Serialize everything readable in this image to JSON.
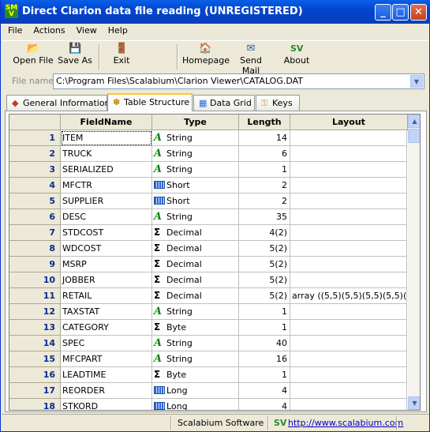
{
  "window": {
    "title": "Direct Clarion data file reading (UNREGISTERED)",
    "icon_text": "SM V"
  },
  "menu": [
    "File",
    "Actions",
    "View",
    "Help"
  ],
  "toolbar": {
    "open_label": "Open File",
    "save_label": "Save As",
    "exit_label": "Exit",
    "homepage_label": "Homepage",
    "sendmail_label": "Send Mail",
    "about_label": "About"
  },
  "filename": {
    "label": "File name:",
    "value": "C:\\Program Files\\Scalabium\\Clarion Viewer\\CATALOG.DAT"
  },
  "tabs": [
    "General Information",
    "Table Structure",
    "Data Grid",
    "Keys"
  ],
  "active_tab": "Table Structure",
  "grid": {
    "columns": [
      "FieldName",
      "Type",
      "Length",
      "Layout"
    ],
    "rows": [
      {
        "n": "1",
        "field": "ITEM",
        "type": "String",
        "icon": "string-icon",
        "length": "14",
        "layout": ""
      },
      {
        "n": "2",
        "field": "TRUCK",
        "type": "String",
        "icon": "string-icon",
        "length": "6",
        "layout": ""
      },
      {
        "n": "3",
        "field": "SERIALIZED",
        "type": "String",
        "icon": "string-icon",
        "length": "1",
        "layout": ""
      },
      {
        "n": "4",
        "field": "MFCTR",
        "type": "Short",
        "icon": "integer-icon",
        "length": "2",
        "layout": ""
      },
      {
        "n": "5",
        "field": "SUPPLIER",
        "type": "Short",
        "icon": "integer-icon",
        "length": "2",
        "layout": ""
      },
      {
        "n": "6",
        "field": "DESC",
        "type": "String",
        "icon": "string-icon",
        "length": "35",
        "layout": ""
      },
      {
        "n": "7",
        "field": "STDCOST",
        "type": "Decimal",
        "icon": "sigma-icon",
        "length": "4(2)",
        "layout": ""
      },
      {
        "n": "8",
        "field": "WDCOST",
        "type": "Decimal",
        "icon": "sigma-icon",
        "length": "5(2)",
        "layout": ""
      },
      {
        "n": "9",
        "field": "MSRP",
        "type": "Decimal",
        "icon": "sigma-icon",
        "length": "5(2)",
        "layout": ""
      },
      {
        "n": "10",
        "field": "JOBBER",
        "type": "Decimal",
        "icon": "sigma-icon",
        "length": "5(2)",
        "layout": ""
      },
      {
        "n": "11",
        "field": "RETAIL",
        "type": "Decimal",
        "icon": "sigma-icon",
        "length": "5(2)",
        "layout": "array ((5,5)(5,5)(5,5)(5,5)(5,5)"
      },
      {
        "n": "12",
        "field": "TAXSTAT",
        "type": "String",
        "icon": "string-icon",
        "length": "1",
        "layout": ""
      },
      {
        "n": "13",
        "field": "CATEGORY",
        "type": "Byte",
        "icon": "sigma-icon",
        "length": "1",
        "layout": ""
      },
      {
        "n": "14",
        "field": "SPEC",
        "type": "String",
        "icon": "string-icon",
        "length": "40",
        "layout": ""
      },
      {
        "n": "15",
        "field": "MFCPART",
        "type": "String",
        "icon": "string-icon",
        "length": "16",
        "layout": ""
      },
      {
        "n": "16",
        "field": "LEADTIME",
        "type": "Byte",
        "icon": "sigma-icon",
        "length": "1",
        "layout": ""
      },
      {
        "n": "17",
        "field": "REORDER",
        "type": "Long",
        "icon": "integer-icon",
        "length": "4",
        "layout": ""
      },
      {
        "n": "18",
        "field": "STKORD",
        "type": "Long",
        "icon": "integer-icon",
        "length": "4",
        "layout": ""
      }
    ]
  },
  "status": {
    "company": "Scalabium Software",
    "url": "http://www.scalabium.com"
  }
}
